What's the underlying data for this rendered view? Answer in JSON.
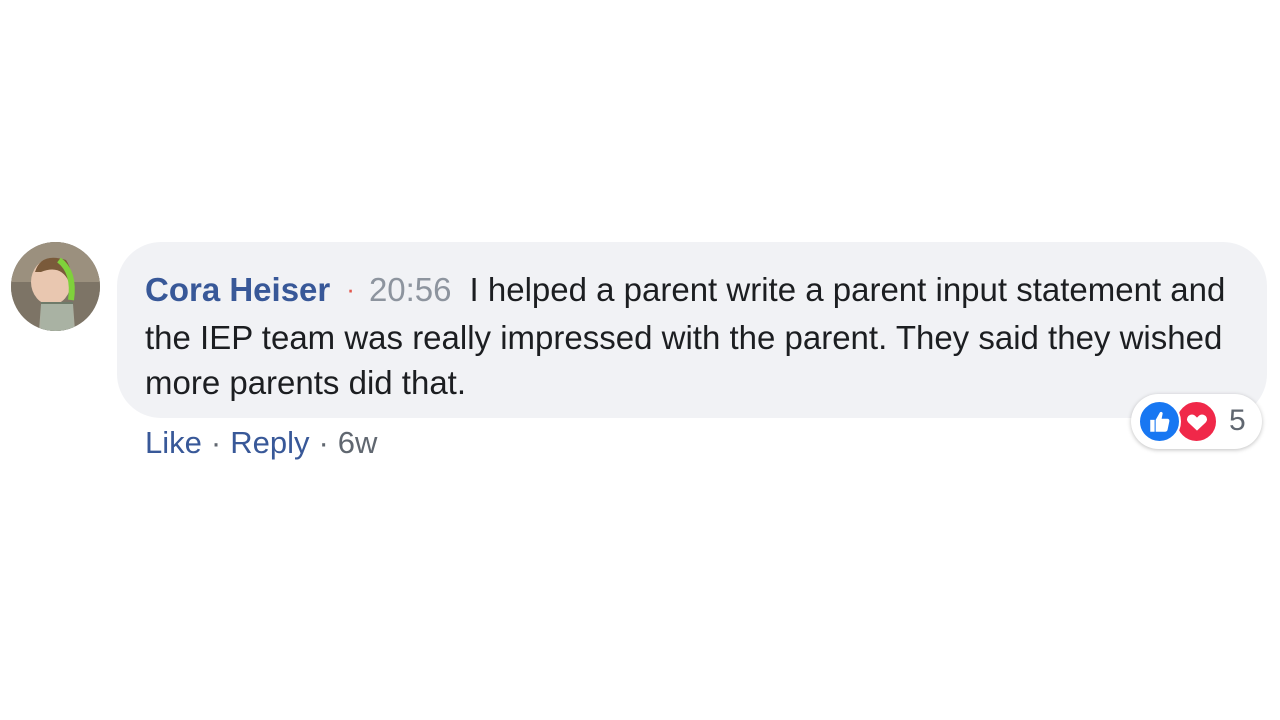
{
  "comment": {
    "author": "Cora Heiser",
    "separator": "·",
    "time": "20:56",
    "text": "I helped a parent write a parent input statement and the IEP team was really impressed with the parent. They said they wished more parents did that.",
    "actions": {
      "like_label": "Like",
      "reply_label": "Reply",
      "dot": "·",
      "age": "6w"
    },
    "reactions": {
      "icons": [
        "like-icon",
        "love-icon"
      ],
      "count": "5"
    }
  },
  "colors": {
    "author": "#385898",
    "bubble": "#f1f2f5",
    "like": "#1877f2",
    "love": "#f02849"
  }
}
